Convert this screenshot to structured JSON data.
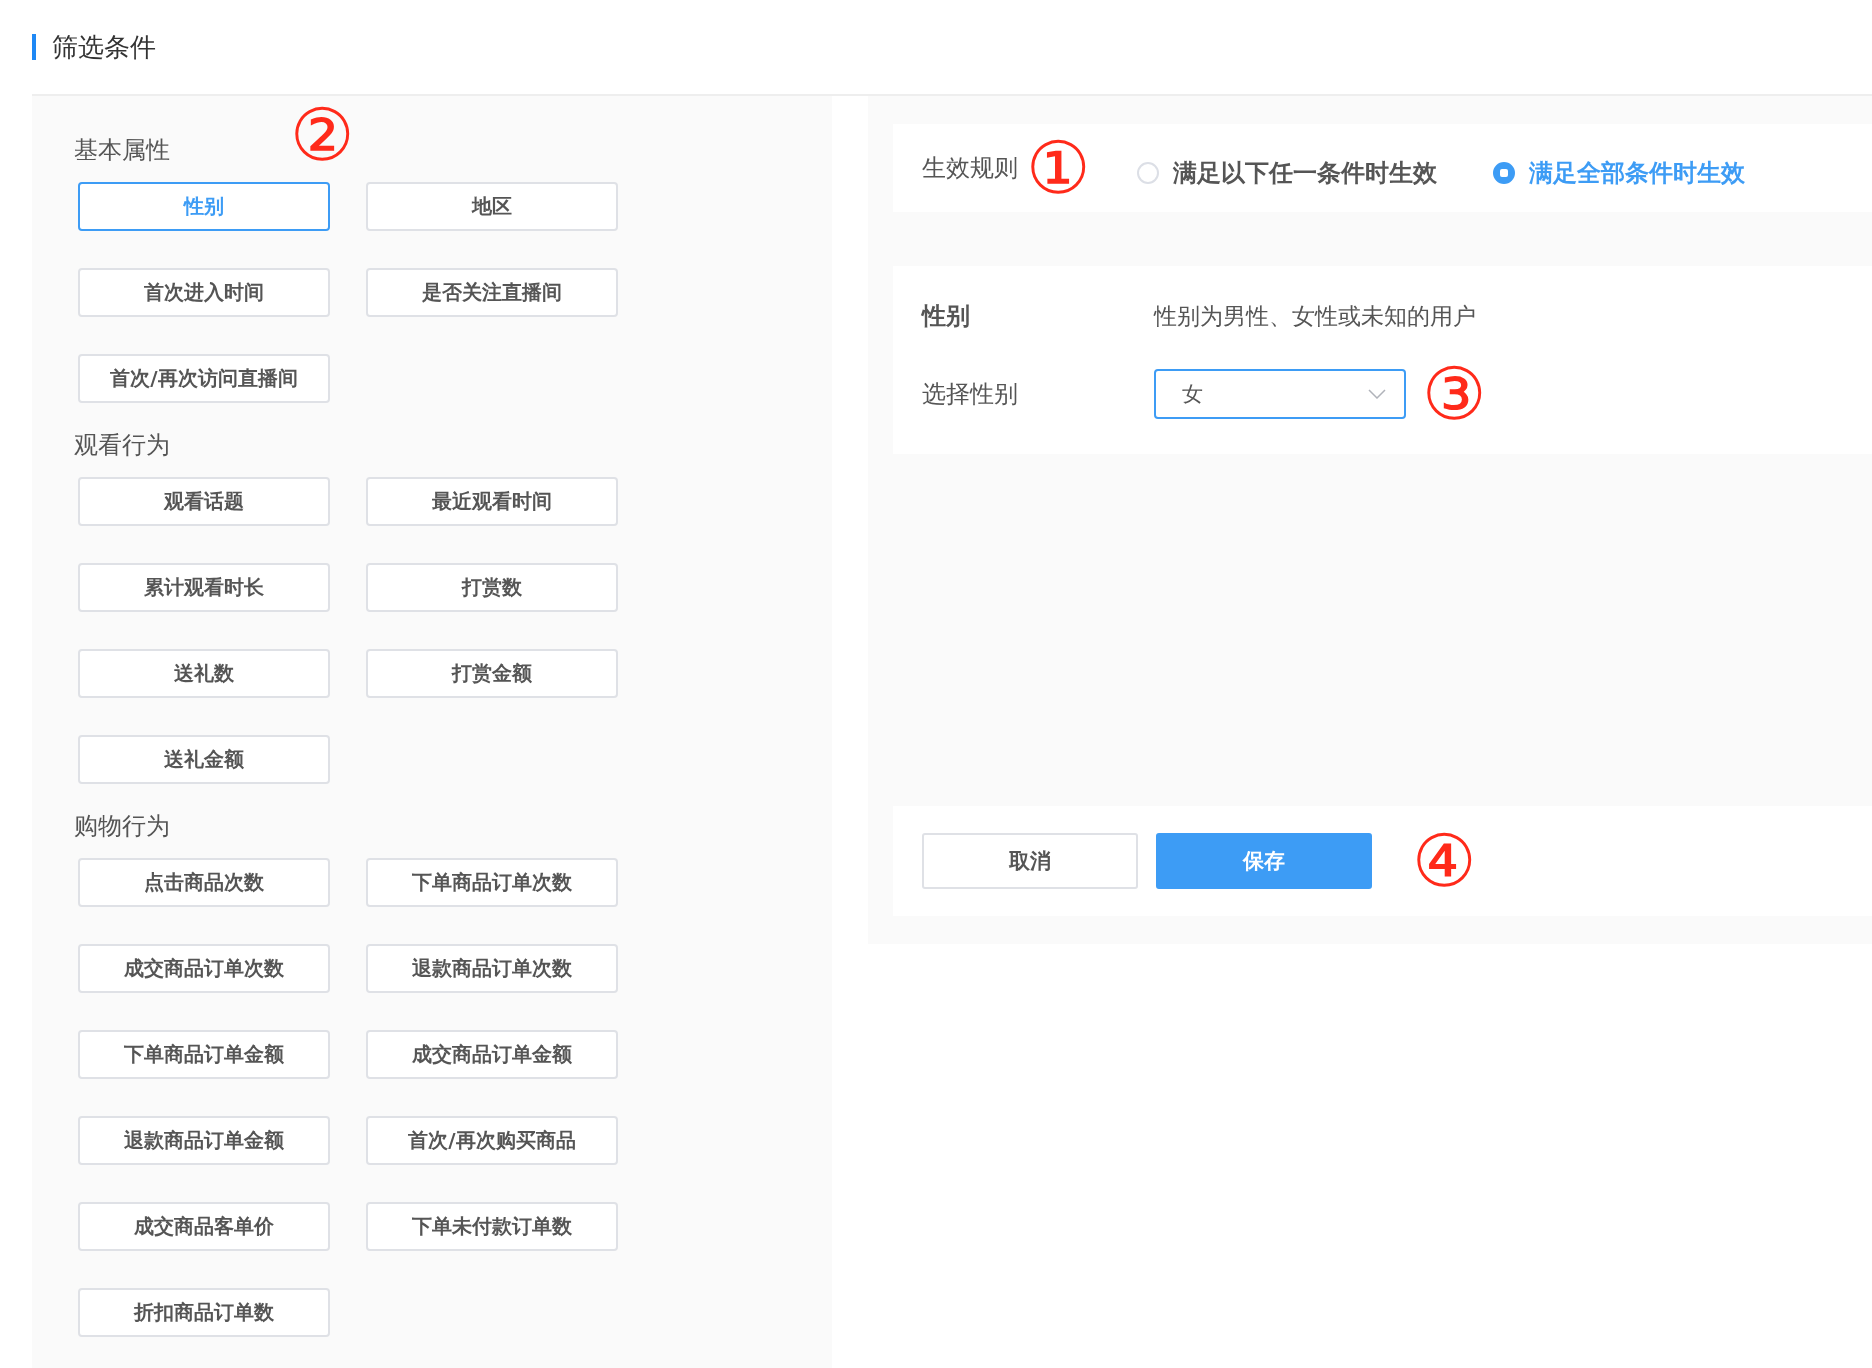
{
  "header": {
    "title": "筛选条件"
  },
  "categories": [
    {
      "title": "基本属性",
      "items": [
        {
          "label": "性别",
          "selected": true
        },
        {
          "label": "地区",
          "selected": false
        },
        {
          "label": "首次进入时间",
          "selected": false
        },
        {
          "label": "是否关注直播间",
          "selected": false
        },
        {
          "label": "首次/再次访问直播间",
          "selected": false
        }
      ]
    },
    {
      "title": "观看行为",
      "items": [
        {
          "label": "观看话题",
          "selected": false
        },
        {
          "label": "最近观看时间",
          "selected": false
        },
        {
          "label": "累计观看时长",
          "selected": false
        },
        {
          "label": "打赏数",
          "selected": false
        },
        {
          "label": "送礼数",
          "selected": false
        },
        {
          "label": "打赏金额",
          "selected": false
        },
        {
          "label": "送礼金额",
          "selected": false
        }
      ]
    },
    {
      "title": "购物行为",
      "items": [
        {
          "label": "点击商品次数",
          "selected": false
        },
        {
          "label": "下单商品订单次数",
          "selected": false
        },
        {
          "label": "成交商品订单次数",
          "selected": false
        },
        {
          "label": "退款商品订单次数",
          "selected": false
        },
        {
          "label": "下单商品订单金额",
          "selected": false
        },
        {
          "label": "成交商品订单金额",
          "selected": false
        },
        {
          "label": "退款商品订单金额",
          "selected": false
        },
        {
          "label": "首次/再次购买商品",
          "selected": false
        },
        {
          "label": "成交商品客单价",
          "selected": false
        },
        {
          "label": "下单未付款订单数",
          "selected": false
        },
        {
          "label": "折扣商品订单数",
          "selected": false
        }
      ]
    }
  ],
  "rule": {
    "label": "生效规则",
    "options": [
      {
        "label": "满足以下任一条件时生效",
        "selected": false
      },
      {
        "label": "满足全部条件时生效",
        "selected": true
      }
    ]
  },
  "condition": {
    "name": "性别",
    "description": "性别为男性、女性或未知的用户",
    "field_label": "选择性别",
    "value": "女"
  },
  "buttons": [
    {
      "label": "取消",
      "kind": "secondary"
    },
    {
      "label": "保存",
      "kind": "primary"
    }
  ],
  "annotations": [
    "①",
    "②",
    "③",
    "④"
  ]
}
